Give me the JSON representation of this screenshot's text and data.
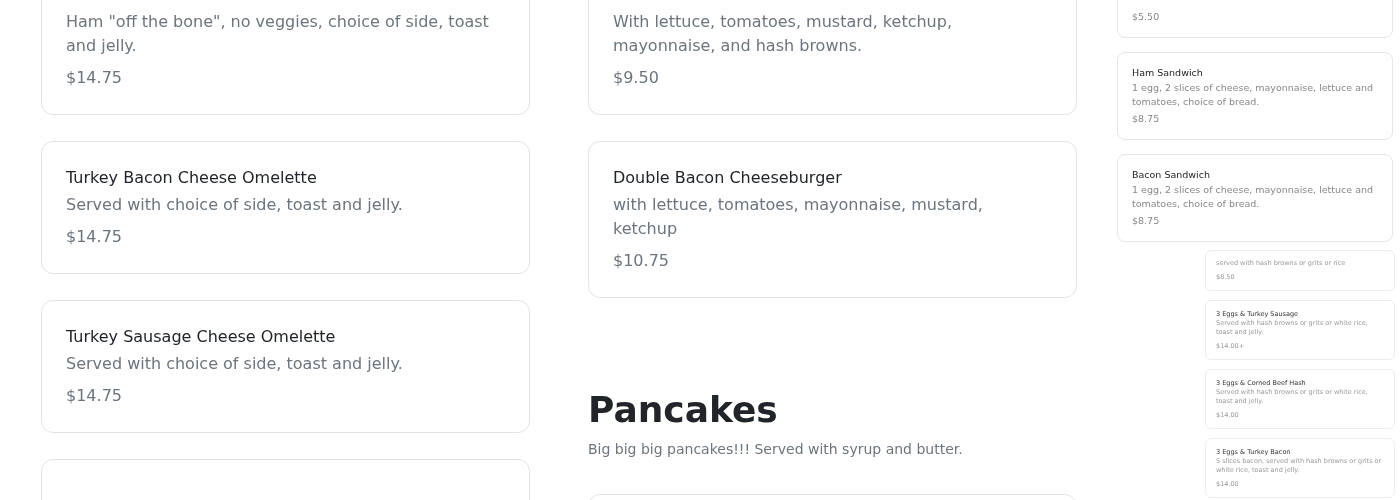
{
  "left_column": {
    "items": [
      {
        "description": "Ham \"off the bone\", no veggies, choice of side, toast and jelly.",
        "price": "$14.75"
      },
      {
        "title": "Turkey Bacon Cheese Omelette",
        "description": "Served with choice of side, toast and jelly.",
        "price": "$14.75"
      },
      {
        "title": "Turkey Sausage Cheese Omelette",
        "description": "Served with choice of side, toast and jelly.",
        "price": "$14.75"
      }
    ]
  },
  "middle_column": {
    "items": [
      {
        "description": "With lettuce, tomatoes, mustard, ketchup, mayonnaise, and hash browns.",
        "price": "$9.50"
      },
      {
        "title": "Double Bacon Cheeseburger",
        "description": "with lettuce, tomatoes, mayonnaise, mustard, ketchup",
        "price": "$10.75"
      }
    ],
    "section": {
      "heading": "Pancakes",
      "subtitle": "Big big big pancakes!!! Served with syrup and butter."
    }
  },
  "right_column": {
    "items": [
      {
        "price": "$5.50"
      },
      {
        "title": "Ham Sandwich",
        "description": "1 egg, 2 slices of cheese, mayonnaise, lettuce and tomatoes, choice of bread.",
        "price": "$8.75"
      },
      {
        "title": "Bacon Sandwich",
        "description": "1 egg, 2 slices of cheese, mayonnaise, lettuce and tomatoes, choice of bread.",
        "price": "$8.75"
      }
    ]
  },
  "inset_column": {
    "items": [
      {
        "description": "served with hash browns or grits or rice",
        "price": "$8.50"
      },
      {
        "title": "3 Eggs & Turkey Sausage",
        "description": "Served with hash browns or grits or white rice, toast and jelly.",
        "price": "$14.00+"
      },
      {
        "title": "3 Eggs & Corned Beef Hash",
        "description": "Served with hash browns or grits or white rice, toast and jelly.",
        "price": "$14.00"
      },
      {
        "title": "3 Eggs & Turkey Bacon",
        "description": "5 slices bacon, served with hash browns or grits or white rice, toast and jelly.",
        "price": "$14.00"
      }
    ]
  }
}
